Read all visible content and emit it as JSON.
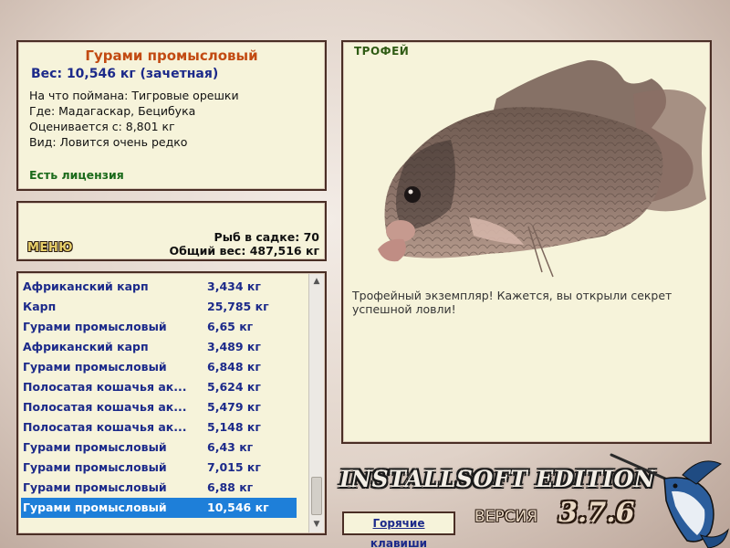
{
  "info": {
    "title": "Гурами промысловый",
    "weight": "Вес: 10,546 кг (зачетная)",
    "bait": "На что поймана: Тигровые орешки",
    "where": "Где: Мадагаскар, Бецибука",
    "value": "Оценивается с: 8,801 кг",
    "kind": "Вид: Ловится очень редко",
    "license": "Есть лицензия"
  },
  "menu": {
    "label": "МЕНЮ"
  },
  "stats": {
    "count": "Рыб в садке: 70",
    "total": "Общий вес: 487,516 кг"
  },
  "catch_list": [
    {
      "name": "Африканский карп",
      "weight": "3,434 кг"
    },
    {
      "name": "Карп",
      "weight": "25,785 кг"
    },
    {
      "name": "Гурами промысловый",
      "weight": "6,65 кг"
    },
    {
      "name": "Африканский карп",
      "weight": "3,489 кг"
    },
    {
      "name": "Гурами промысловый",
      "weight": "6,848 кг"
    },
    {
      "name": "Полосатая кошачья ак...",
      "weight": "5,624 кг"
    },
    {
      "name": "Полосатая кошачья ак...",
      "weight": "5,479 кг"
    },
    {
      "name": "Полосатая кошачья ак...",
      "weight": "5,148 кг"
    },
    {
      "name": "Гурами промысловый",
      "weight": "6,43 кг"
    },
    {
      "name": "Гурами промысловый",
      "weight": "7,015 кг"
    },
    {
      "name": "Гурами промысловый",
      "weight": "6,88 кг"
    },
    {
      "name": "Гурами промысловый",
      "weight": "10,546 кг",
      "selected": true
    }
  ],
  "trophy": {
    "label": "ТРОФЕЙ",
    "text": "Трофейный экземпляр! Кажется, вы открыли секрет успешной ловли!"
  },
  "branding": {
    "edition": "INSTALLSOFT EDITION",
    "version_word": "ВЕРСИЯ",
    "version": "3.7.6"
  },
  "hotkeys": {
    "label": "Горячие клавиши"
  },
  "colors": {
    "panel_bg": "#f6f3da",
    "panel_border": "#4a2e25",
    "title": "#c24a12",
    "list_text": "#1c2a8a",
    "selection": "#1e7fd9",
    "license": "#1a6a1a"
  }
}
